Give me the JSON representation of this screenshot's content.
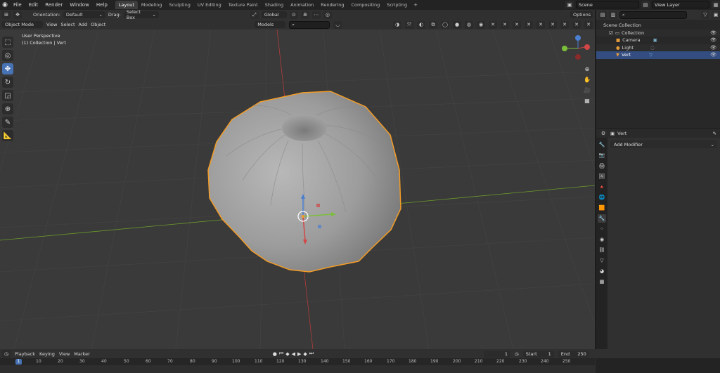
{
  "menubar": {
    "items": [
      "File",
      "Edit",
      "Render",
      "Window",
      "Help"
    ],
    "workspaces": [
      "Layout",
      "Modeling",
      "Sculpting",
      "UV Editing",
      "Texture Paint",
      "Shading",
      "Animation",
      "Rendering",
      "Compositing",
      "Scripting"
    ],
    "active_workspace": "Layout",
    "add_workspace": "+",
    "scene": "Scene",
    "view_layer": "View Layer"
  },
  "toolbar": {
    "orientation_label": "Orientation:",
    "orientation_value": "Default",
    "drag_label": "Drag:",
    "drag_value": "Select Box",
    "transform_orientation": "Global",
    "options": "Options"
  },
  "viewport_header": {
    "mode": "Object Mode",
    "menus": [
      "View",
      "Select",
      "Add",
      "Object"
    ],
    "models_label": "Models"
  },
  "viewport": {
    "perspective": "User Perspective",
    "collection_info": "(1) Collection | Vert"
  },
  "outliner": {
    "scene_collection": "Scene Collection",
    "collection": "Collection",
    "objects": [
      {
        "name": "Camera"
      },
      {
        "name": "Light"
      },
      {
        "name": "Vert"
      }
    ]
  },
  "properties": {
    "object_name": "Vert",
    "add_modifier": "Add Modifier"
  },
  "timeline": {
    "menus": [
      "Playback",
      "Keying",
      "View",
      "Marker"
    ],
    "current_frame": "1",
    "start_label": "Start",
    "start_value": "1",
    "end_label": "End",
    "end_value": "250",
    "ruler": [
      "10",
      "20",
      "30",
      "40",
      "50",
      "60",
      "70",
      "80",
      "90",
      "100",
      "110",
      "120",
      "130",
      "140",
      "150",
      "160",
      "170",
      "180",
      "190",
      "200",
      "210",
      "220",
      "230",
      "240",
      "250"
    ]
  },
  "colors": {
    "accent": "#4772b3",
    "selection_outline": "#f39c26",
    "x_axis": "#b23a3a",
    "y_axis": "#6a9a2a"
  }
}
